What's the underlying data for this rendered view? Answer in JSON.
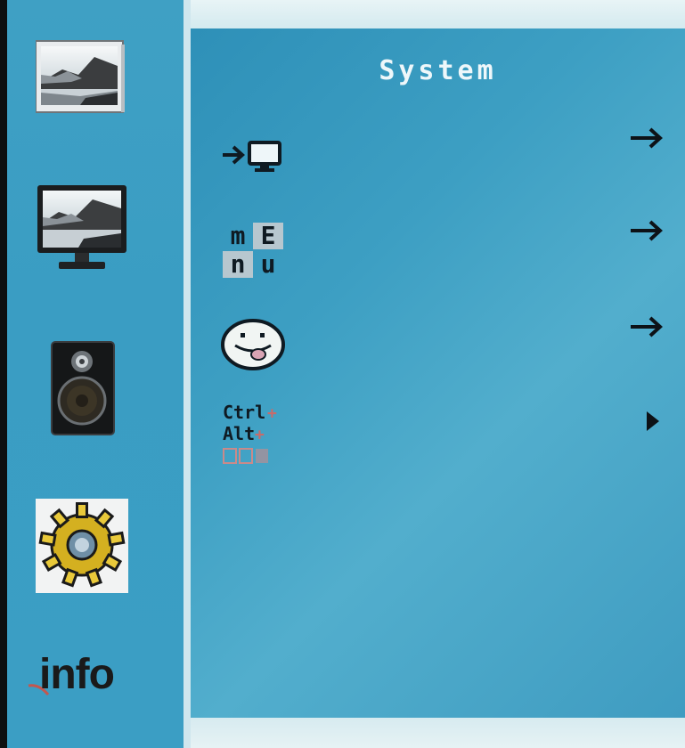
{
  "menu": {
    "title": "System"
  },
  "sidebar": {
    "items": [
      {
        "name": "picture",
        "icon": "landscape-photo-icon"
      },
      {
        "name": "display",
        "icon": "monitor-icon"
      },
      {
        "name": "audio",
        "icon": "speaker-icon"
      },
      {
        "name": "system",
        "icon": "gear-icon"
      },
      {
        "name": "info",
        "label": "info",
        "icon": "info-icon"
      }
    ]
  },
  "rows": [
    {
      "icon": "input-source-icon",
      "arrow": "arrow-right-icon"
    },
    {
      "icon": "menu-settings-icon",
      "icon_text": [
        "m",
        "E",
        "n",
        "u"
      ],
      "arrow": "arrow-right-icon"
    },
    {
      "icon": "smiley-icon",
      "arrow": "arrow-right-icon"
    },
    {
      "icon": "hotkey-icon",
      "icon_text": [
        "Ctrl",
        "Alt"
      ],
      "arrow": "triangle-right-icon"
    }
  ],
  "colors": {
    "panel": "#3d9fc3",
    "sidebar": "#3a9dc3",
    "title": "#eef7fa",
    "icon_dark": "#0f1a22"
  }
}
